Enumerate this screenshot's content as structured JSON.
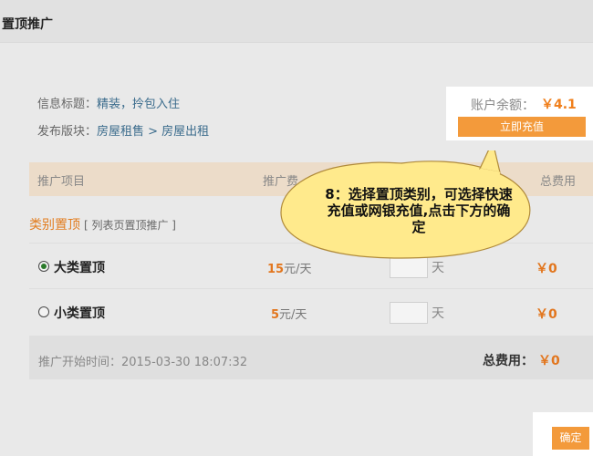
{
  "header": {
    "title": "置顶推广"
  },
  "info": {
    "title_label": "信息标题：",
    "title_value": "精装，拎包入住",
    "board_label": "发布版块：",
    "board_value": "房屋租售 > 房屋出租"
  },
  "account": {
    "balance_label": "账户余额：",
    "balance_value": "￥4.1",
    "recharge_label": "立即充值"
  },
  "table": {
    "headers": [
      "推广项目",
      "推广费",
      "总费用"
    ]
  },
  "section": {
    "name": "类别置顶",
    "desc": "[ 列表页置顶推广 ]"
  },
  "options": [
    {
      "label": "大类置顶",
      "price": "15",
      "price_unit": "元/天",
      "days_unit": "天",
      "fee": "￥0",
      "selected": true
    },
    {
      "label": "小类置顶",
      "price": "5",
      "price_unit": "元/天",
      "days_unit": "天",
      "fee": "￥0",
      "selected": false
    }
  ],
  "footer": {
    "start_time_label": "推广开始时间：",
    "start_time_value": "2015-03-30 18:07:32",
    "total_label": "总费用：",
    "total_value": "￥0"
  },
  "confirm_label": "确定",
  "callout": {
    "line1": "8：选择置顶类别，可选择快速",
    "line2": "充值或网银充值,点击下方的确",
    "line3": "定"
  },
  "colors": {
    "accent": "#f39a3b",
    "price": "#e2761e",
    "callout_fill": "#ffea8c"
  }
}
